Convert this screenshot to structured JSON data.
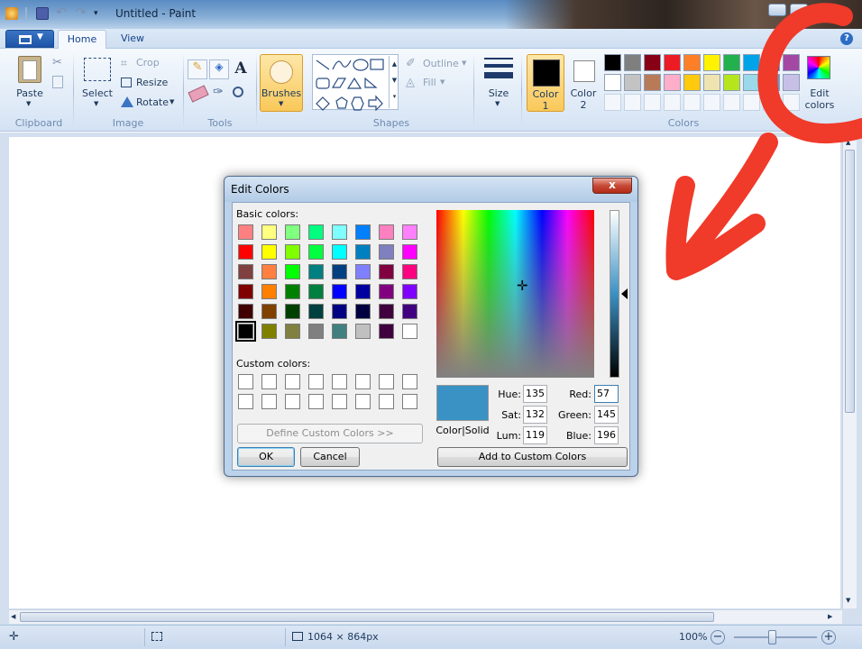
{
  "window": {
    "title": "Untitled - Paint"
  },
  "tabs": [
    {
      "label": "Home"
    },
    {
      "label": "View"
    }
  ],
  "ribbon": {
    "clipboard": {
      "paste": "Paste",
      "group": "Clipboard"
    },
    "image": {
      "select": "Select",
      "crop": "Crop",
      "resize": "Resize",
      "rotate": "Rotate",
      "group": "Image"
    },
    "tools": {
      "group": "Tools"
    },
    "brushes": {
      "label": "Brushes"
    },
    "shapes": {
      "outline": "Outline",
      "fill": "Fill",
      "group": "Shapes"
    },
    "size": {
      "label": "Size"
    },
    "color1": {
      "label1": "Color",
      "label2": "1",
      "value": "#000000"
    },
    "color2": {
      "label1": "Color",
      "label2": "2",
      "value": "#ffffff"
    },
    "colors": {
      "group": "Colors",
      "row1": [
        "#000000",
        "#7f7f7f",
        "#880015",
        "#ed1c24",
        "#ff7f27",
        "#fff200",
        "#22b14c",
        "#00a2e8",
        "#3f48cc",
        "#a349a4"
      ],
      "row2": [
        "#ffffff",
        "#c3c3c3",
        "#b97a57",
        "#ffaec9",
        "#ffc90e",
        "#efe4b0",
        "#b5e61d",
        "#99d9ea",
        "#7092be",
        "#c8bfe7"
      ]
    },
    "edit_colors": {
      "label1": "Edit",
      "label2": "colors"
    }
  },
  "status": {
    "dimensions": "1064 × 864px",
    "zoom": "100%"
  },
  "dialog": {
    "title": "Edit Colors",
    "close": "x",
    "basic_label": "Basic colors:",
    "custom_label": "Custom colors:",
    "basic_colors": [
      [
        "#ff8080",
        "#ffff80",
        "#80ff80",
        "#00ff80",
        "#80ffff",
        "#0080ff",
        "#ff80c0",
        "#ff80ff"
      ],
      [
        "#ff0000",
        "#ffff00",
        "#80ff00",
        "#00ff40",
        "#00ffff",
        "#0080c0",
        "#8080c0",
        "#ff00ff"
      ],
      [
        "#804040",
        "#ff8040",
        "#00ff00",
        "#008080",
        "#004080",
        "#8080ff",
        "#800040",
        "#ff0080"
      ],
      [
        "#800000",
        "#ff8000",
        "#008000",
        "#008040",
        "#0000ff",
        "#0000a0",
        "#800080",
        "#8000ff"
      ],
      [
        "#400000",
        "#804000",
        "#004000",
        "#004040",
        "#000080",
        "#000040",
        "#400040",
        "#400080"
      ],
      [
        "#000000",
        "#808000",
        "#808040",
        "#808080",
        "#408080",
        "#c0c0c0",
        "#400040",
        "#ffffff"
      ]
    ],
    "define_custom": "Define Custom Colors >>",
    "ok": "OK",
    "cancel": "Cancel",
    "preview_label": "Color|Solid",
    "preview_color": "#3991c4",
    "hue_label": "Hue:",
    "hue": "135",
    "sat_label": "Sat:",
    "sat": "132",
    "lum_label": "Lum:",
    "lum": "119",
    "red_label": "Red:",
    "red": "57",
    "green_label": "Green:",
    "green": "145",
    "blue_label": "Blue:",
    "blue": "196",
    "add_custom": "Add to Custom Colors"
  },
  "annotation_color": "#f03a2a"
}
